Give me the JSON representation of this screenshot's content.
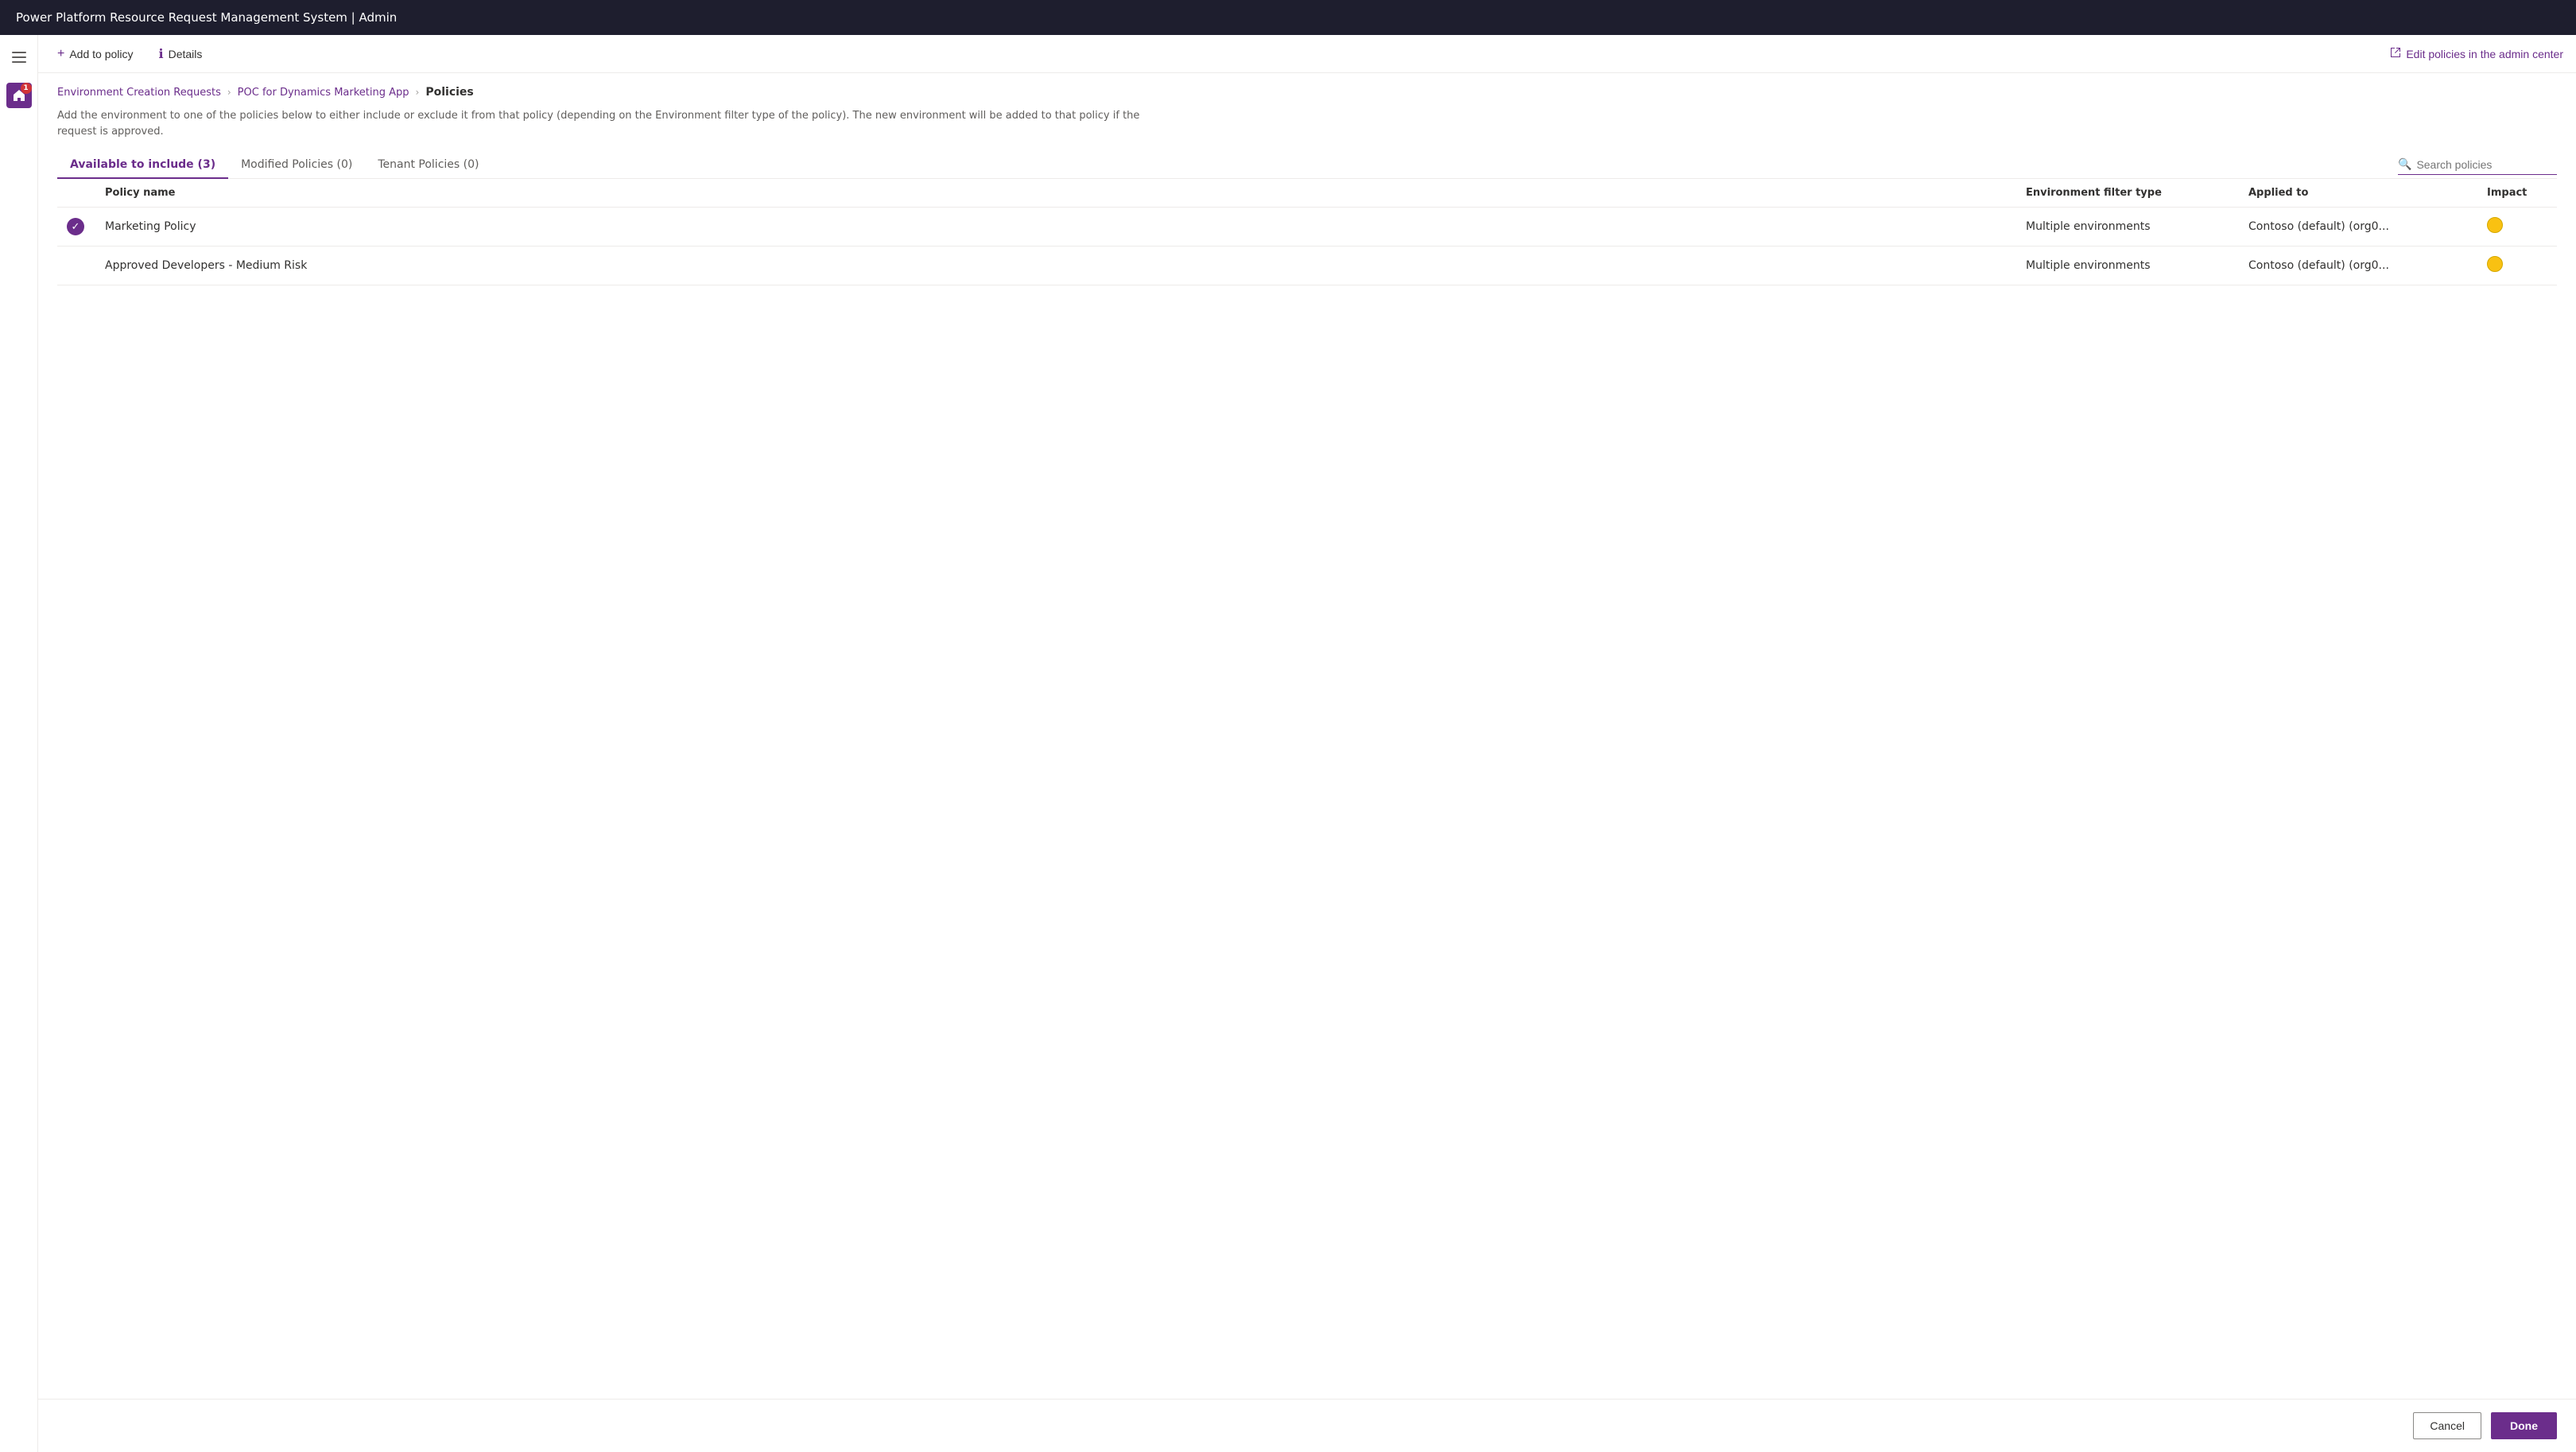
{
  "app": {
    "title": "Power Platform Resource Request Management System | Admin"
  },
  "toolbar": {
    "add_to_policy_label": "Add to policy",
    "details_label": "Details",
    "edit_policies_label": "Edit policies in the admin center"
  },
  "breadcrumb": {
    "item1": "Environment Creation Requests",
    "item2": "POC for Dynamics Marketing App",
    "item3": "Policies"
  },
  "description": "Add the environment to one of the policies below to either include or exclude it from that policy (depending on the Environment filter type of the policy). The new environment will be added to that policy if the request is approved.",
  "tabs": [
    {
      "label": "Available to include (3)",
      "active": true
    },
    {
      "label": "Modified Policies (0)",
      "active": false
    },
    {
      "label": "Tenant Policies (0)",
      "active": false
    }
  ],
  "search": {
    "placeholder": "Search policies"
  },
  "table": {
    "columns": [
      {
        "key": "check",
        "label": ""
      },
      {
        "key": "name",
        "label": "Policy name"
      },
      {
        "key": "filter",
        "label": "Environment filter type"
      },
      {
        "key": "applied",
        "label": "Applied to"
      },
      {
        "key": "impact",
        "label": "Impact"
      }
    ],
    "rows": [
      {
        "checked": true,
        "name": "Marketing Policy",
        "filter": "Multiple environments",
        "applied": "Contoso (default) (org0...",
        "impact_color": "#f9c112"
      },
      {
        "checked": false,
        "name": "Approved Developers - Medium Risk",
        "filter": "Multiple environments",
        "applied": "Contoso (default) (org0...",
        "impact_color": "#f9c112"
      }
    ]
  },
  "footer": {
    "cancel_label": "Cancel",
    "done_label": "Done"
  },
  "nav": {
    "badge_count": "1"
  }
}
